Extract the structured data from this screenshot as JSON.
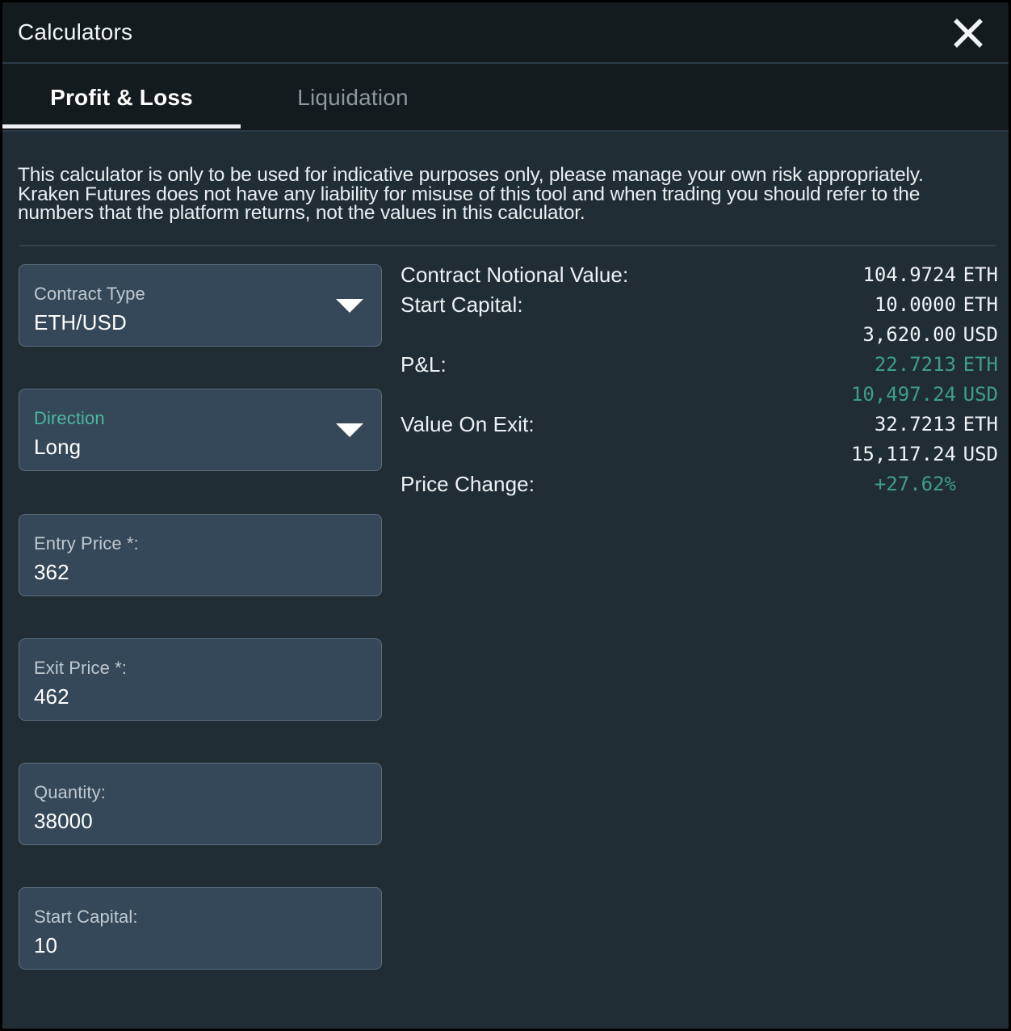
{
  "window": {
    "title": "Calculators",
    "close_icon": "close-icon"
  },
  "tabs": [
    {
      "label": "Profit & Loss",
      "active": true
    },
    {
      "label": "Liquidation",
      "active": false
    }
  ],
  "disclaimer": "This calculator is only to be used for indicative purposes only, please manage your own risk appropriately. Kraken Futures does not have any liability for misuse of this tool and when trading you should refer to the numbers that the platform returns, not the values in this calculator.",
  "form": {
    "contract_type": {
      "label": "Contract Type",
      "value": "ETH/USD",
      "caret_icon": "chevron-down-icon"
    },
    "direction": {
      "label": "Direction",
      "value": "Long",
      "caret_icon": "chevron-down-icon",
      "label_color": "#4cb79b"
    },
    "entry_price": {
      "label": "Entry Price *:",
      "value": "362"
    },
    "exit_price": {
      "label": "Exit Price *:",
      "value": "462"
    },
    "quantity": {
      "label": "Quantity:",
      "value": "38000"
    },
    "start_capital": {
      "label": "Start Capital:",
      "value": "10"
    }
  },
  "results": [
    {
      "label": "Contract Notional Value:",
      "number": "104.9724",
      "unit": "ETH",
      "positive": false
    },
    {
      "label": "Start Capital:",
      "number": "10.0000",
      "unit": "ETH",
      "positive": false
    },
    {
      "label": "",
      "number": "3,620.00",
      "unit": "USD",
      "positive": false
    },
    {
      "label": "P&L:",
      "number": "22.7213",
      "unit": "ETH",
      "positive": true
    },
    {
      "label": "",
      "number": "10,497.24",
      "unit": "USD",
      "positive": true
    },
    {
      "label": "Value On Exit:",
      "number": "32.7213",
      "unit": "ETH",
      "positive": false
    },
    {
      "label": "",
      "number": "15,117.24",
      "unit": "USD",
      "positive": false
    },
    {
      "label": "Price Change:",
      "number": "+27.62%",
      "unit": "",
      "positive": true
    }
  ],
  "colors": {
    "accent_green": "#3f9f86",
    "titlebar_bg": "#141b1f",
    "body_bg": "#212d35",
    "field_bg": "#34485a"
  }
}
